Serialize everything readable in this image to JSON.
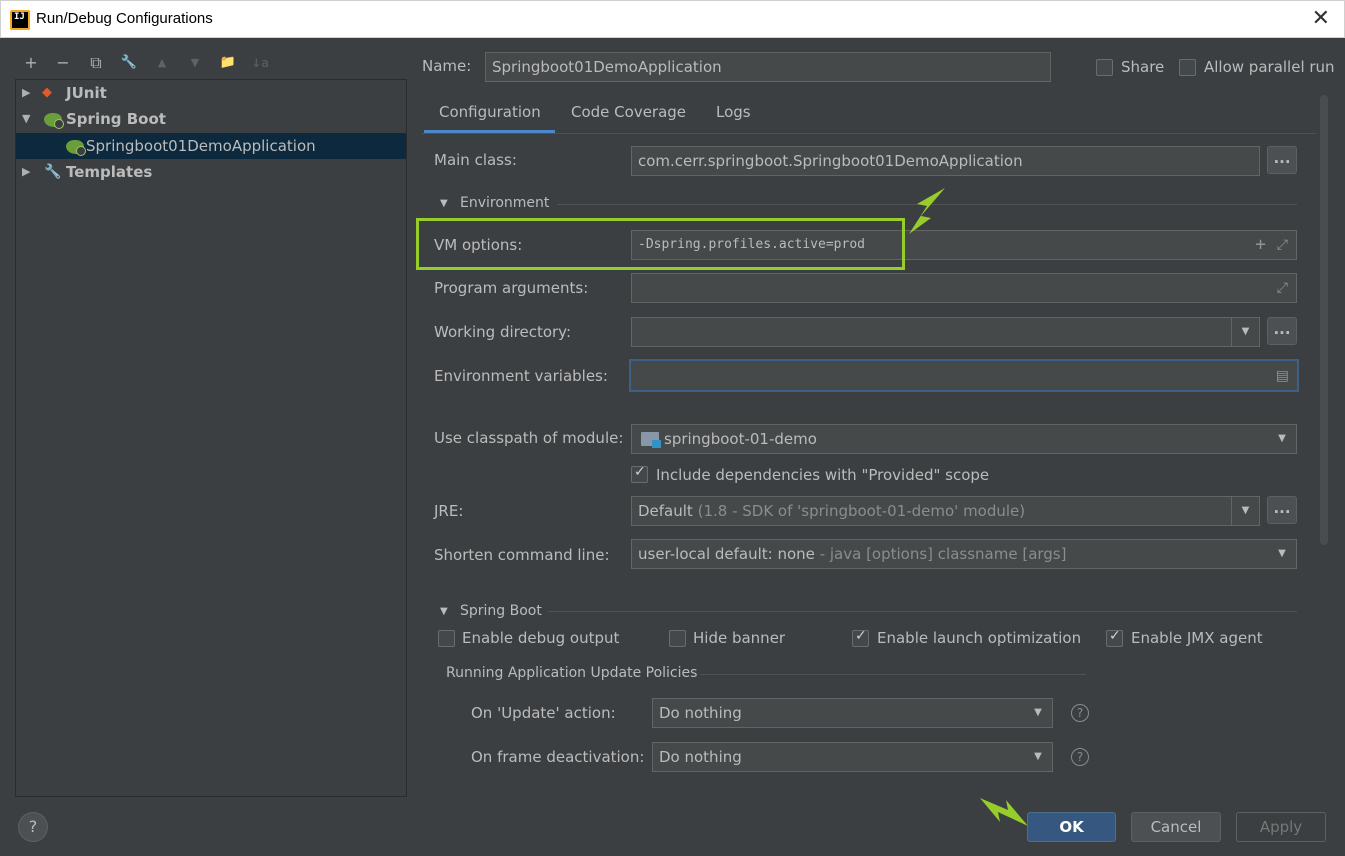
{
  "window": {
    "title": "Run/Debug Configurations",
    "close": "✕"
  },
  "toolbar": {
    "add": "+",
    "remove": "−",
    "copy": "⧉",
    "edit": "🔧",
    "up": "▲",
    "down": "▼",
    "folder": "📁",
    "sort": "↓a"
  },
  "tree": {
    "items": [
      {
        "label": "JUnit",
        "arrow": "▶"
      },
      {
        "label": "Spring Boot",
        "arrow": "▼"
      },
      {
        "label": "Springboot01DemoApplication"
      },
      {
        "label": "Templates",
        "arrow": "▶"
      }
    ]
  },
  "header": {
    "name_label": "Name:",
    "name_value": "Springboot01DemoApplication",
    "share_label": "Share",
    "share_checked": false,
    "parallel_label": "Allow parallel run",
    "parallel_checked": false
  },
  "tabs": [
    {
      "label": "Configuration",
      "active": true
    },
    {
      "label": "Code Coverage"
    },
    {
      "label": "Logs"
    }
  ],
  "config": {
    "main_class_label": "Main class:",
    "main_class_value": "com.cerr.springboot.Springboot01DemoApplication",
    "environment_section": "Environment",
    "vm_options_label": "VM options:",
    "vm_options_value": "-Dspring.profiles.active=prod",
    "program_args_label": "Program arguments:",
    "program_args_value": "",
    "working_dir_label": "Working directory:",
    "working_dir_value": "",
    "env_vars_label": "Environment variables:",
    "env_vars_value": "",
    "classpath_label": "Use classpath of module:",
    "classpath_value": "springboot-01-demo",
    "include_deps_label": "Include dependencies with \"Provided\" scope",
    "include_deps_checked": true,
    "jre_label": "JRE:",
    "jre_value_main": "Default",
    "jre_value_detail": "(1.8 - SDK of 'springboot-01-demo' module)",
    "shorten_label": "Shorten command line:",
    "shorten_value_main": "user-local default: none",
    "shorten_value_detail": "- java [options] classname [args]",
    "dots": "..."
  },
  "springboot": {
    "section": "Spring Boot",
    "debug_output_label": "Enable debug output",
    "debug_output_checked": false,
    "hide_banner_label": "Hide banner",
    "hide_banner_checked": false,
    "launch_opt_label": "Enable launch optimization",
    "launch_opt_checked": true,
    "jmx_label": "Enable JMX agent",
    "jmx_checked": true,
    "policies_title": "Running Application Update Policies",
    "update_action_label": "On 'Update' action:",
    "update_action_value": "Do nothing",
    "frame_deact_label": "On frame deactivation:",
    "frame_deact_value": "Do nothing"
  },
  "footer": {
    "help": "?",
    "ok": "OK",
    "cancel": "Cancel",
    "apply": "Apply"
  },
  "colors": {
    "accent": "#4a88c7",
    "highlight": "#96cd2b",
    "primary_button": "#365880",
    "background": "#3c3f41"
  }
}
